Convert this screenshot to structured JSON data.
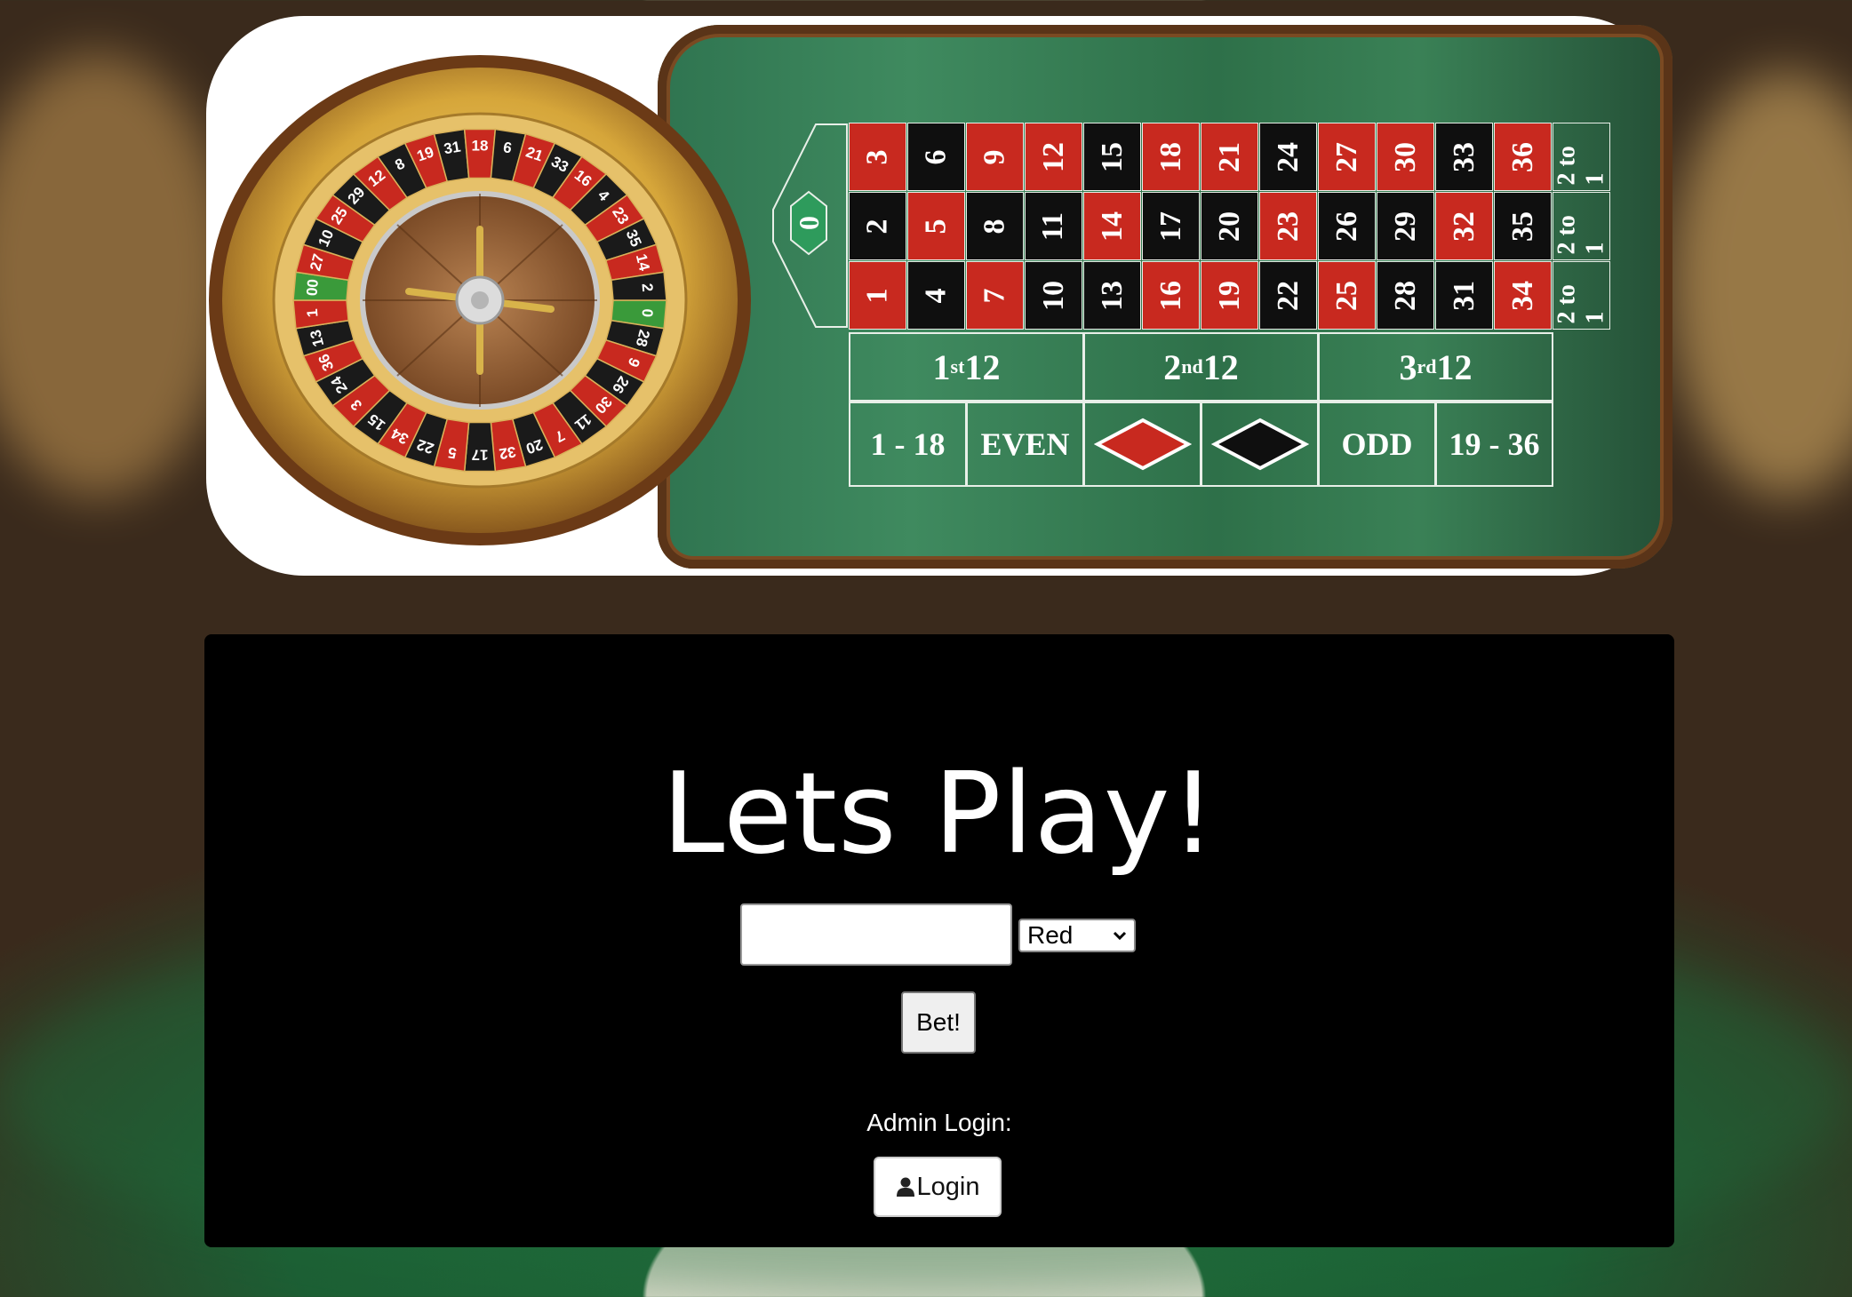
{
  "table": {
    "zero": "0",
    "rows": [
      [
        "3",
        "6",
        "9",
        "12",
        "15",
        "18",
        "21",
        "24",
        "27",
        "30",
        "33",
        "36"
      ],
      [
        "2",
        "5",
        "8",
        "11",
        "14",
        "17",
        "20",
        "23",
        "26",
        "29",
        "32",
        "35"
      ],
      [
        "1",
        "4",
        "7",
        "10",
        "13",
        "16",
        "19",
        "22",
        "25",
        "28",
        "31",
        "34"
      ]
    ],
    "row_colors": [
      [
        "red",
        "black",
        "red",
        "red",
        "black",
        "red",
        "red",
        "black",
        "red",
        "red",
        "black",
        "red"
      ],
      [
        "black",
        "red",
        "black",
        "black",
        "red",
        "black",
        "black",
        "red",
        "black",
        "black",
        "red",
        "black"
      ],
      [
        "red",
        "black",
        "red",
        "black",
        "black",
        "red",
        "red",
        "black",
        "red",
        "black",
        "black",
        "red"
      ]
    ],
    "column_bets": [
      "2 to 1",
      "2 to 1",
      "2 to 1"
    ],
    "dozens": [
      {
        "num": "1",
        "sup": "st",
        "rest": " 12"
      },
      {
        "num": "2",
        "sup": "nd",
        "rest": "12"
      },
      {
        "num": "3",
        "sup": "rd",
        "rest": "12"
      }
    ],
    "outside": [
      "1 - 18",
      "EVEN",
      "",
      "",
      "ODD",
      "19 - 36"
    ],
    "colors": {
      "red": "#c8291f",
      "black": "#0f0f0f",
      "felt": "#2f7450"
    }
  },
  "wheel": {
    "numbers": [
      "0",
      "28",
      "9",
      "26",
      "30",
      "11",
      "7",
      "20",
      "32",
      "17",
      "5",
      "22",
      "34",
      "15",
      "3",
      "24",
      "36",
      "13",
      "1",
      "00",
      "27",
      "10",
      "25",
      "29",
      "12",
      "8",
      "19",
      "31",
      "18",
      "6",
      "21",
      "33",
      "16",
      "4",
      "23",
      "35",
      "14",
      "2"
    ]
  },
  "panel": {
    "title": "Lets Play!",
    "amount_value": "",
    "color_select": {
      "selected": "Red",
      "options": [
        "Red",
        "Black"
      ]
    },
    "bet_label": "Bet!",
    "admin_label": "Admin Login:",
    "login_label": "Login",
    "login_icon": "user-icon"
  }
}
